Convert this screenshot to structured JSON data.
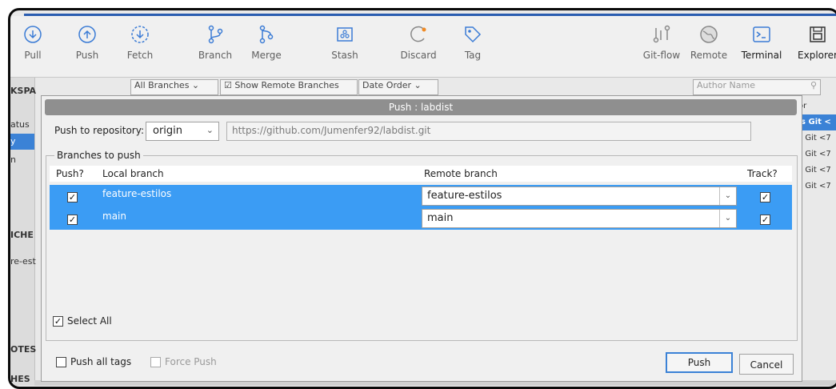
{
  "toolbar": {
    "items": [
      {
        "label": "Pull",
        "icon": "pull-icon"
      },
      {
        "label": "Push",
        "icon": "push-icon"
      },
      {
        "label": "Fetch",
        "icon": "fetch-icon"
      },
      {
        "label": "Branch",
        "icon": "branch-icon"
      },
      {
        "label": "Merge",
        "icon": "merge-icon"
      },
      {
        "label": "Stash",
        "icon": "stash-icon"
      },
      {
        "label": "Discard",
        "icon": "discard-icon"
      },
      {
        "label": "Tag",
        "icon": "tag-icon"
      },
      {
        "label": "Git-flow",
        "icon": "git-flow-icon"
      },
      {
        "label": "Remote",
        "icon": "remote-icon"
      },
      {
        "label": "Terminal",
        "icon": "terminal-icon"
      },
      {
        "label": "Explorer",
        "icon": "explorer-icon"
      }
    ]
  },
  "sidebar": {
    "workspace": "KSPA",
    "status": "atus",
    "selected": "y",
    "item3": "n",
    "branches_header": "ICHE",
    "branch1": "re-est",
    "remotes_header": "OTES",
    "other": "HES"
  },
  "filters": {
    "branches": "All Branches",
    "show_remote": "Show Remote Branches",
    "order": "Date Order",
    "author_placeholder": "Author Name"
  },
  "right_col": {
    "header": "or",
    "rows": [
      "'s Git <",
      "s Git <7",
      "s Git <7",
      "s Git <7",
      "s Git <7"
    ]
  },
  "dialog": {
    "title": "Push : labdist",
    "push_to_label": "Push to repository:",
    "repo": "origin",
    "url": "https://github.com/Jumenfer92/labdist.git",
    "group_label": "Branches to push",
    "columns": {
      "push": "Push?",
      "local": "Local branch",
      "remote": "Remote branch",
      "track": "Track?"
    },
    "branches": [
      {
        "push": true,
        "local": "feature-estilos",
        "remote": "feature-estilos",
        "track": true
      },
      {
        "push": true,
        "local": "main",
        "remote": "main",
        "track": true
      }
    ],
    "select_all": "Select All",
    "push_all_tags": "Push all tags",
    "force_push": "Force Push",
    "push_button": "Push",
    "cancel_button": "Cancel"
  },
  "colors": {
    "selection": "#3b9cf4",
    "accent": "#2a5db0"
  }
}
